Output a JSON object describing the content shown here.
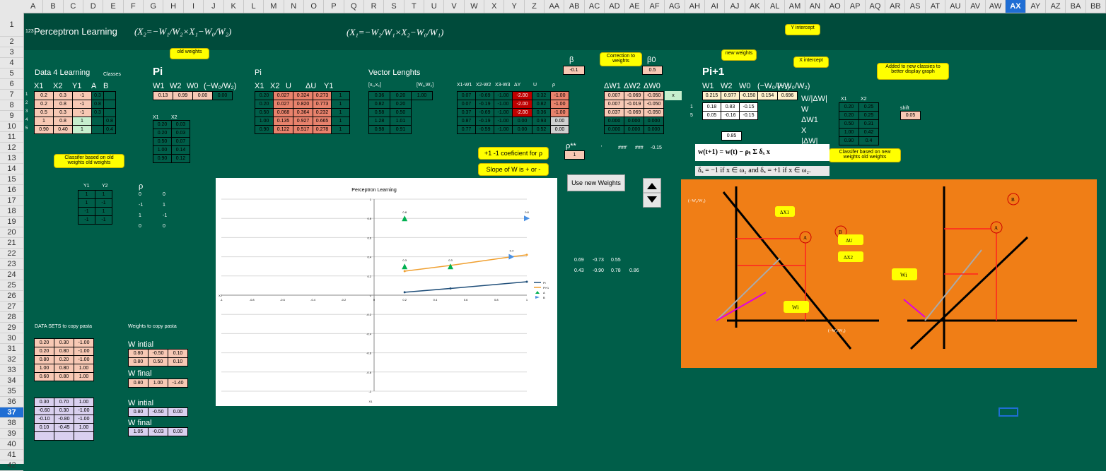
{
  "columns": [
    "A",
    "B",
    "C",
    "D",
    "E",
    "F",
    "G",
    "H",
    "I",
    "J",
    "K",
    "L",
    "M",
    "N",
    "O",
    "P",
    "Q",
    "R",
    "S",
    "T",
    "U",
    "V",
    "W",
    "X",
    "Y",
    "Z",
    "AA",
    "AB",
    "AC",
    "AD",
    "AE",
    "AF",
    "AG",
    "AH",
    "AI",
    "AJ",
    "AK",
    "AL",
    "AM",
    "AN",
    "AO",
    "AP",
    "AQ",
    "AR",
    "AS",
    "AT",
    "AU",
    "AV",
    "AW",
    "AX",
    "AY",
    "AZ",
    "BA",
    "BB"
  ],
  "selected_column": "AX",
  "rows": [
    "1",
    "2",
    "3",
    "4",
    "5",
    "6",
    "7",
    "8",
    "9",
    "10",
    "11",
    "12",
    "13",
    "14",
    "15",
    "16",
    "17",
    "18",
    "19",
    "20",
    "21",
    "22",
    "23",
    "24",
    "25",
    "26",
    "27",
    "28",
    "29",
    "30",
    "31",
    "32",
    "33",
    "34",
    "35",
    "36",
    "37",
    "38",
    "39",
    "40",
    "41",
    "42"
  ],
  "selected_row": "37",
  "banner": {
    "icon": "123",
    "title": "Perceptron Learning",
    "formula1": "(X₂=−W₁/W₂×X₁−W₀/W₂)",
    "formula2": "(X₁=−W₂/W₁×X₂−W₀/W₁)"
  },
  "callouts": {
    "old_weights": "old weights",
    "correction": "Correction to weights",
    "new_weights": "new weights",
    "y_intercept": "Y intercept",
    "x_intercept": "X intercept",
    "added": "Added to new classies to better display graph",
    "classifier_old": "Classifer based on old weights old weights",
    "classifier_new": "Classifer based on new weights old weights",
    "rho_coef": "+1 -1 coeficient for ρ",
    "slope": "Slope of W is + or -"
  },
  "data4": {
    "label": "Data 4 Learning",
    "classes": "Classes",
    "headers": [
      "X1",
      "X2",
      "Y1",
      "A",
      "B"
    ],
    "idx": [
      "1",
      "2",
      "3",
      "4",
      "5"
    ],
    "rows": [
      [
        "0.2",
        "0.3",
        "-1",
        "0.3",
        ""
      ],
      [
        "0.2",
        "0.8",
        "-1",
        "0.8",
        ""
      ],
      [
        "0.5",
        "0.3",
        "-1",
        "0.3",
        ""
      ],
      [
        "1",
        "0.8",
        "1",
        "",
        "0.8"
      ],
      [
        "0.90",
        "0.40",
        "1",
        "",
        "0.4"
      ]
    ]
  },
  "pi": {
    "label": "Pi",
    "headers": [
      "W1",
      "W2",
      "W0",
      "(−W₀/W₂)"
    ],
    "values": [
      "0.13",
      "0.99",
      "0.00",
      "0.00"
    ],
    "sub_headers": [
      "X1",
      "X2"
    ],
    "sub_rows": [
      [
        "0.20",
        "0.03"
      ],
      [
        "0.20",
        "0.03"
      ],
      [
        "0.50",
        "0.07"
      ],
      [
        "1.00",
        "0.14"
      ],
      [
        "0.90",
        "0.12"
      ]
    ]
  },
  "pi2": {
    "label": "Pi",
    "headers": [
      "X1",
      "X2",
      "U",
      "ΔU",
      "Y1"
    ],
    "rows": [
      [
        "0.20",
        "0.027",
        "0.324",
        "0.273",
        "1"
      ],
      [
        "0.20",
        "0.027",
        "0.820",
        "0.773",
        "1"
      ],
      [
        "0.50",
        "0.068",
        "0.364",
        "0.232",
        "1"
      ],
      [
        "1.00",
        "0.135",
        "0.927",
        "0.665",
        "1"
      ],
      [
        "0.90",
        "0.122",
        "0.517",
        "0.278",
        "1"
      ]
    ]
  },
  "vector": {
    "label": "Vector Lenghts",
    "headers": [
      "[x₁,x₂]",
      "",
      "[W₁,W₂]"
    ],
    "w_len": "1.00",
    "rows": [
      [
        "0.36",
        "0.20"
      ],
      [
        "0.82",
        "0.20"
      ],
      [
        "0.58",
        "0.50"
      ],
      [
        "1.28",
        "1.01"
      ],
      [
        "0.98",
        "0.91"
      ]
    ]
  },
  "diffs": {
    "headers": [
      "X1-W1",
      "X2-W2",
      "X3-W3",
      "ΔY",
      "U",
      "ρ"
    ],
    "rows": [
      [
        "0.07",
        "-0.69",
        "-1.00",
        "-2.00",
        "0.32",
        "-1.00"
      ],
      [
        "0.07",
        "-0.19",
        "-1.00",
        "-2.00",
        "0.82",
        "-1.00"
      ],
      [
        "0.37",
        "-0.69",
        "-1.00",
        "-2.00",
        "0.36",
        "-1.00"
      ],
      [
        "0.87",
        "-0.19",
        "-1.00",
        "0.00",
        "0.93",
        "0.00"
      ],
      [
        "0.77",
        "-0.59",
        "-1.00",
        "0.00",
        "0.52",
        "0.00"
      ]
    ]
  },
  "beta": {
    "label": "β",
    "value": "-0.1",
    "b0_label": "β0",
    "b0_value": "0.5",
    "rho_label": "ρ**",
    "rho_value": "1"
  },
  "dw": {
    "headers": [
      "ΔW1",
      "ΔW2",
      "ΔW0"
    ],
    "x_label": "x",
    "rows": [
      [
        "0.007",
        "-0.069",
        "-0.050"
      ],
      [
        "0.007",
        "-0.019",
        "-0.050"
      ],
      [
        "0.037",
        "-0.069",
        "-0.050"
      ],
      [
        "0.000",
        "0.000",
        "0.000"
      ],
      [
        "0.000",
        "0.000",
        "0.000"
      ]
    ],
    "marks": [
      "'",
      "###'",
      "###",
      "-0.15"
    ]
  },
  "pi1": {
    "label": "Pi+1",
    "headers": [
      "W1",
      "W2",
      "W0",
      "(−W₀/W₁)",
      "(−W₀/W₂)"
    ],
    "values": [
      "0.215",
      "0.977",
      "-0.150",
      "0.154",
      "0.696"
    ],
    "rows": [
      [
        "1",
        "0.18",
        "0.83",
        "-0.15"
      ],
      [
        "5",
        "0.05",
        "-0.16",
        "-0.15"
      ]
    ],
    "norm": "0.85",
    "legend": [
      "W/|ΔW|",
      "W",
      "ΔW1",
      "X",
      "|ΔW|"
    ]
  },
  "new_xy": {
    "headers": [
      "X1",
      "X2"
    ],
    "rows": [
      [
        "0.20",
        "0.25"
      ],
      [
        "0.20",
        "0.25"
      ],
      [
        "0.50",
        "0.31"
      ],
      [
        "1.00",
        "0.42"
      ],
      [
        "0.90",
        "0.4"
      ]
    ],
    "shift_label": "shift",
    "shift_value": "0.05"
  },
  "formula": {
    "update": "w(t+1) = w(t) − ρₜ Σ δₓ x",
    "delta": "δₓ = −1 if x ∈ ω₁ and δₓ = +1 if x ∈ ω₂."
  },
  "yy": {
    "headers": [
      "Y1",
      "Y2"
    ],
    "rows": [
      [
        "1",
        "1"
      ],
      [
        "1",
        "-1"
      ],
      [
        "-1",
        "1"
      ],
      [
        "-1",
        "-1"
      ]
    ],
    "rho_label": "ρ",
    "rho_rows": [
      [
        "0",
        "0"
      ],
      [
        "-1",
        "1"
      ],
      [
        "1",
        "-1"
      ],
      [
        "0",
        "0"
      ]
    ]
  },
  "stray": {
    "row1": [
      "0.69",
      "-0.73",
      "0.55"
    ],
    "row2": [
      "0.43",
      "-0.90",
      "0.78",
      "0.86"
    ]
  },
  "datasets": {
    "label": "DATA SETS to copy pasta",
    "set1": [
      [
        "0.20",
        "0.30",
        "-1.00"
      ],
      [
        "0.20",
        "0.80",
        "-1.00"
      ],
      [
        "0.80",
        "0.20",
        "-1.00"
      ],
      [
        "1.00",
        "0.80",
        "1.00"
      ],
      [
        "0.60",
        "0.80",
        "1.00"
      ]
    ],
    "set2": [
      [
        "0.30",
        "0.70",
        "1.00"
      ],
      [
        "-0.60",
        "0.30",
        "-1.00"
      ],
      [
        "-0.10",
        "-0.80",
        "-1.00"
      ],
      [
        "0.10",
        "-0.45",
        "1.00"
      ],
      [
        "",
        "",
        ""
      ]
    ]
  },
  "weights": {
    "label": "Weights to copy pasta",
    "w_initial": "W intial",
    "w_final": "W final",
    "wi1": [
      [
        "0.80",
        "-0.50",
        "0.10"
      ],
      [
        "0.80",
        "0.50",
        "0.10"
      ]
    ],
    "wf1": [
      "0.80",
      "1.00",
      "-1.40"
    ],
    "wi2": [
      "0.80",
      "-0.50",
      "0.00"
    ],
    "wf2": [
      "1.05",
      "-0.03",
      "0.00"
    ]
  },
  "button": {
    "label": "Use new Weights"
  },
  "diagram": {
    "label_w0w2": "(−W₀/W₁)",
    "label_w0w1": "(−W₀/W₂)",
    "dx1": "ΔX1",
    "du": "ΔU",
    "dx2": "ΔX2",
    "wi": "Wi",
    "a": "A",
    "b": "B"
  },
  "chart_data": {
    "type": "scatter",
    "title": "Perceptron Learning",
    "xlabel": "X1",
    "ylabel": "X2",
    "xlim": [
      -1,
      1
    ],
    "ylim": [
      -1,
      1
    ],
    "x_ticks": [
      "-1",
      "-0.8",
      "-0.6",
      "-0.4",
      "-0.2",
      "0",
      "0.2",
      "0.4",
      "0.6",
      "0.8",
      "1"
    ],
    "y_ticks": [
      "1",
      "0.8",
      "0.6",
      "0.4",
      "0.2",
      "0",
      "-0.2",
      "-0.4",
      "-0.6",
      "-0.8",
      "-1"
    ],
    "series": [
      {
        "name": "Pi",
        "style": "line",
        "color": "#1f4e79",
        "x": [
          0.2,
          0.5,
          1.0
        ],
        "y": [
          0.03,
          0.07,
          0.14
        ]
      },
      {
        "name": "Pi+1",
        "style": "line",
        "color": "#f0a030",
        "x": [
          0.2,
          0.5,
          0.9,
          1.0
        ],
        "y": [
          0.25,
          0.31,
          0.4,
          0.42
        ]
      },
      {
        "name": "A",
        "style": "triangle-up",
        "color": "#00b050",
        "x": [
          0.2,
          0.2,
          0.5
        ],
        "y": [
          0.3,
          0.8,
          0.3
        ],
        "labels": [
          "0.3",
          "0.8",
          "0.3"
        ]
      },
      {
        "name": "B",
        "style": "triangle-right",
        "color": "#4a90e2",
        "x": [
          1.0,
          0.9
        ],
        "y": [
          0.8,
          0.4
        ],
        "labels": [
          "0.8",
          "0.4"
        ]
      }
    ],
    "legend": "right"
  }
}
